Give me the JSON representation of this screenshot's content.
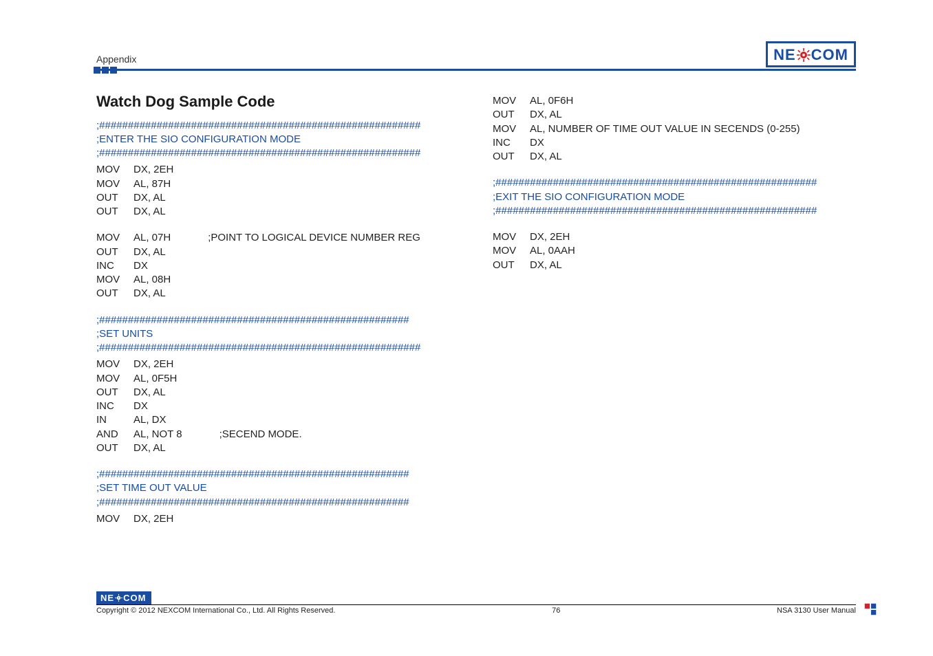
{
  "header": {
    "appendix_label": "Appendix",
    "logo_ne": "NE",
    "logo_com": "COM"
  },
  "title": "Watch Dog Sample Code",
  "hash54": ";######################################################",
  "hash56": ";########################################################",
  "sections": {
    "enter": ";ENTER THE SIO CONFIGURATION MODE",
    "units": ";SET UNITS",
    "timeout": ";SET TIME OUT VALUE",
    "exit": ";EXIT THE SIO CONFIGURATION MODE"
  },
  "left": {
    "block1": [
      {
        "op": "MOV",
        "args": "DX, 2EH",
        "cmt": ""
      },
      {
        "op": "MOV",
        "args": "AL, 87H",
        "cmt": ""
      },
      {
        "op": "OUT",
        "args": "DX, AL",
        "cmt": ""
      },
      {
        "op": "OUT",
        "args": "DX, AL",
        "cmt": ""
      }
    ],
    "block2": [
      {
        "op": "MOV",
        "args": "AL, 07H",
        "cmt": ";POINT TO LOGICAL DEVICE NUMBER REG"
      },
      {
        "op": "OUT",
        "args": "DX, AL",
        "cmt": ""
      },
      {
        "op": "INC",
        "args": "DX",
        "cmt": ""
      },
      {
        "op": "MOV",
        "args": "AL, 08H",
        "cmt": ""
      },
      {
        "op": "OUT",
        "args": "DX, AL",
        "cmt": ""
      }
    ],
    "block3": [
      {
        "op": "MOV",
        "args": "DX, 2EH",
        "cmt": ""
      },
      {
        "op": "MOV",
        "args": "AL, 0F5H",
        "cmt": ""
      },
      {
        "op": "OUT",
        "args": "DX, AL",
        "cmt": ""
      },
      {
        "op": "INC",
        "args": "DX",
        "cmt": ""
      },
      {
        "op": "IN",
        "args": "AL, DX",
        "cmt": ""
      },
      {
        "op": "AND",
        "args": "AL, NOT 8",
        "cmt": ";SECEND MODE."
      },
      {
        "op": "OUT",
        "args": "DX, AL",
        "cmt": ""
      }
    ],
    "block4": [
      {
        "op": "MOV",
        "args": "DX, 2EH",
        "cmt": ""
      }
    ]
  },
  "right": {
    "block1": [
      {
        "op": "MOV",
        "args": "AL, 0F6H",
        "cmt": ""
      },
      {
        "op": "OUT",
        "args": "DX, AL",
        "cmt": ""
      },
      {
        "op": "MOV",
        "args": "AL, NUMBER OF TIME OUT VALUE IN SECENDS (0-255)",
        "cmt": ""
      },
      {
        "op": "INC",
        "args": "DX",
        "cmt": ""
      },
      {
        "op": "OUT",
        "args": "DX, AL",
        "cmt": ""
      }
    ],
    "block2": [
      {
        "op": "MOV",
        "args": "DX, 2EH",
        "cmt": ""
      },
      {
        "op": "MOV",
        "args": "AL, 0AAH",
        "cmt": ""
      },
      {
        "op": "OUT",
        "args": "DX, AL",
        "cmt": ""
      }
    ]
  },
  "footer": {
    "copyright": "Copyright © 2012 NEXCOM International Co., Ltd. All Rights Reserved.",
    "page_number": "76",
    "manual_label": "NSA 3130 User Manual"
  }
}
